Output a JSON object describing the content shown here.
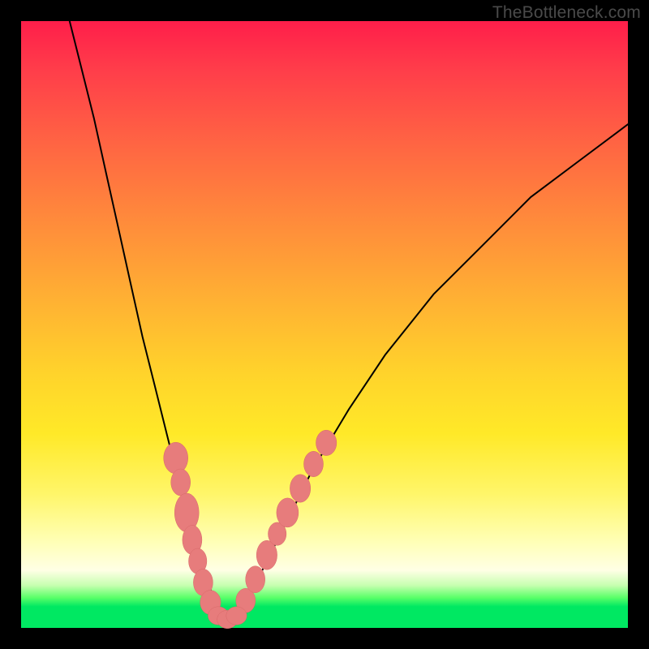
{
  "watermark": "TheBottleneck.com",
  "chart_data": {
    "type": "line",
    "title": "",
    "xlabel": "",
    "ylabel": "",
    "xlim": [
      0,
      100
    ],
    "ylim": [
      0,
      100
    ],
    "series": [
      {
        "name": "left-branch",
        "x": [
          8,
          10,
          12,
          14,
          16,
          18,
          20,
          22,
          24,
          26,
          28,
          30,
          32,
          33
        ],
        "y": [
          100,
          92,
          84,
          75,
          66,
          57,
          48,
          40,
          32,
          24,
          17,
          10,
          4,
          1
        ]
      },
      {
        "name": "right-branch",
        "x": [
          35,
          37,
          40,
          44,
          48,
          54,
          60,
          68,
          76,
          84,
          92,
          100
        ],
        "y": [
          1,
          4,
          10,
          18,
          26,
          36,
          45,
          55,
          63,
          71,
          77,
          83
        ]
      }
    ],
    "floor": {
      "x": [
        33,
        35
      ],
      "y": [
        1,
        1
      ]
    },
    "beads_left": [
      {
        "x": 25.5,
        "y": 28,
        "rx": 2.0,
        "ry": 2.6
      },
      {
        "x": 26.3,
        "y": 24,
        "rx": 1.6,
        "ry": 2.2
      },
      {
        "x": 27.3,
        "y": 19,
        "rx": 2.0,
        "ry": 3.2
      },
      {
        "x": 28.2,
        "y": 14.5,
        "rx": 1.6,
        "ry": 2.4
      },
      {
        "x": 29.1,
        "y": 11,
        "rx": 1.5,
        "ry": 2.1
      },
      {
        "x": 30.0,
        "y": 7.5,
        "rx": 1.6,
        "ry": 2.2
      },
      {
        "x": 31.2,
        "y": 4.2,
        "rx": 1.7,
        "ry": 2.0
      }
    ],
    "beads_right": [
      {
        "x": 37.0,
        "y": 4.5,
        "rx": 1.6,
        "ry": 2.0
      },
      {
        "x": 38.6,
        "y": 8.0,
        "rx": 1.6,
        "ry": 2.2
      },
      {
        "x": 40.5,
        "y": 12.0,
        "rx": 1.7,
        "ry": 2.4
      },
      {
        "x": 42.2,
        "y": 15.5,
        "rx": 1.5,
        "ry": 1.9
      },
      {
        "x": 43.9,
        "y": 19.0,
        "rx": 1.8,
        "ry": 2.4
      },
      {
        "x": 46.0,
        "y": 23.0,
        "rx": 1.7,
        "ry": 2.3
      },
      {
        "x": 48.2,
        "y": 27.0,
        "rx": 1.6,
        "ry": 2.1
      },
      {
        "x": 50.3,
        "y": 30.5,
        "rx": 1.7,
        "ry": 2.1
      }
    ],
    "beads_bottom": [
      {
        "x": 32.5,
        "y": 2.0,
        "rx": 1.7,
        "ry": 1.5
      },
      {
        "x": 34.0,
        "y": 1.4,
        "rx": 1.7,
        "ry": 1.5
      },
      {
        "x": 35.5,
        "y": 2.0,
        "rx": 1.7,
        "ry": 1.5
      }
    ],
    "gradient_stops": [
      {
        "pos": 0,
        "color": "#ff1e4a"
      },
      {
        "pos": 0.33,
        "color": "#ff8b3b"
      },
      {
        "pos": 0.68,
        "color": "#ffe928"
      },
      {
        "pos": 0.9,
        "color": "#ffffe5"
      },
      {
        "pos": 0.96,
        "color": "#00e862"
      }
    ]
  }
}
